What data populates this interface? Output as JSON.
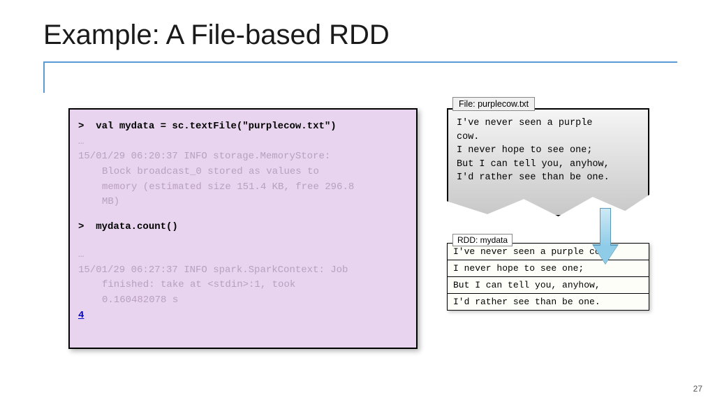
{
  "title": "Example: A File-based RDD",
  "code": {
    "line1_prompt": ">",
    "line1_cmd": "val mydata = sc.textFile(\"purplecow.txt\")",
    "log1a": "15/01/29 06:20:37 INFO storage.MemoryStore:",
    "log1b": "Block broadcast_0 stored as values to",
    "log1c": "memory (estimated size 151.4 KB, free 296.8",
    "log1d": "MB)",
    "line2_prompt": ">",
    "line2_cmd": "mydata.count()",
    "log2a": "15/01/29 06:27:37 INFO spark.SparkContext: Job",
    "log2b": "finished: take at <stdin>:1, took",
    "log2c": "0.160482078 s",
    "result": "4"
  },
  "file": {
    "label": "File: purplecow.txt",
    "lines": [
      "I've never seen a purple",
      "cow.",
      "I never hope to see one;",
      "But I can tell you, anyhow,",
      "I'd rather see than be one."
    ]
  },
  "rdd": {
    "label": "RDD: mydata",
    "rows": [
      "I've never seen a purple cow.",
      "I never hope to see one;",
      "But I can tell you, anyhow,",
      "I'd rather see than be one."
    ]
  },
  "page_number": "27"
}
